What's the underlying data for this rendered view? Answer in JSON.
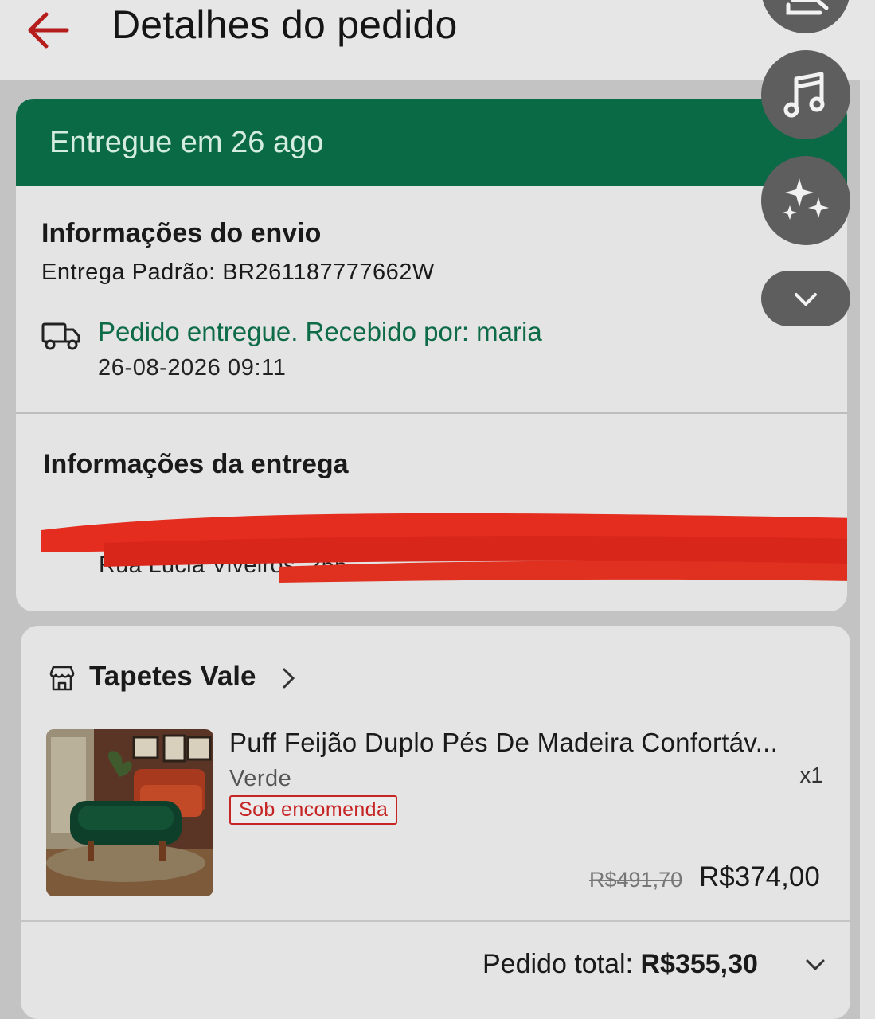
{
  "header": {
    "title": "Detalhes do pedido"
  },
  "status": {
    "text": "Entregue em 26 ago"
  },
  "shipping": {
    "section_title": "Informações do envio",
    "method": "Entrega Padrão: BR261187777662W",
    "tracking_status": "Pedido entregue. Recebido por: maria",
    "tracking_time": "26-08-2026 09:11"
  },
  "delivery": {
    "section_title": "Informações da entrega",
    "address_line": "Rua Lúcia Viveiros, 255"
  },
  "store": {
    "name": "Tapetes Vale"
  },
  "product": {
    "name": "Puff Feijão Duplo Pés De Madeira Confortáv...",
    "variant": "Verde",
    "quantity": "x1",
    "badge": "Sob encomenda",
    "original_price": "R$491,70",
    "price": "R$374,00"
  },
  "order_total": {
    "label": "Pedido total: ",
    "value": "R$355,30"
  },
  "floating_buttons": [
    "edit-icon",
    "music-note-icon",
    "sparkles-icon",
    "chevron-down-icon"
  ],
  "colors": {
    "accent_green": "#0a6a46",
    "delivered_text": "#0e6b48",
    "badge_red": "#c62525",
    "back_arrow": "#b51c1c"
  }
}
